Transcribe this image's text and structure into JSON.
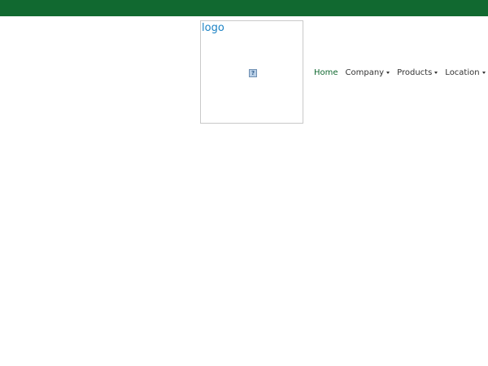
{
  "colors": {
    "topbar": "#116930",
    "logo_text": "#1b82c4",
    "nav_active": "#116930",
    "nav_text": "#333333"
  },
  "header": {
    "logo_alt": "logo",
    "logo_icon": "broken-image-icon"
  },
  "nav": {
    "items": [
      {
        "label": "Home",
        "dropdown": false,
        "active": true
      },
      {
        "label": "Company",
        "dropdown": true,
        "active": false
      },
      {
        "label": "Products",
        "dropdown": true,
        "active": false
      },
      {
        "label": "Location",
        "dropdown": true,
        "active": false
      }
    ]
  }
}
